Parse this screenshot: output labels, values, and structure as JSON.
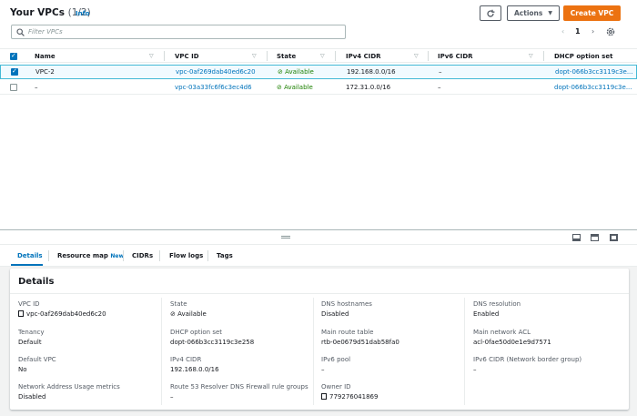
{
  "header": {
    "title": "Your VPCs",
    "count": "(1/2)",
    "info": "Info"
  },
  "toolbar": {
    "actions_label": "Actions",
    "create_label": "Create VPC",
    "refresh_icon": "refresh-icon",
    "settings_icon": "gear-icon"
  },
  "search": {
    "placeholder": "Filter VPCs"
  },
  "pagination": {
    "page": "1"
  },
  "table": {
    "columns": [
      "Name",
      "VPC ID",
      "State",
      "IPv4 CIDR",
      "IPv6 CIDR",
      "DHCP option set"
    ],
    "rows": [
      {
        "selected": true,
        "name": "VPC-2",
        "vpc_id": "vpc-0af269dab40ed6c20",
        "state": "Available",
        "ipv4": "192.168.0.0/16",
        "ipv6": "–",
        "dhcp": "dopt-066b3cc3119c3e..."
      },
      {
        "selected": false,
        "name": "–",
        "vpc_id": "vpc-03a33fc6f6c3ec4d6",
        "state": "Available",
        "ipv4": "172.31.0.0/16",
        "ipv6": "–",
        "dhcp": "dopt-066b3cc3119c3e..."
      }
    ]
  },
  "tabs": {
    "details": "Details",
    "resource_map": "Resource map",
    "new_badge": "New",
    "cidrs": "CIDRs",
    "flow_logs": "Flow logs",
    "tags": "Tags"
  },
  "details": {
    "title": "Details",
    "vpc_id_label": "VPC ID",
    "vpc_id": "vpc-0af269dab40ed6c20",
    "tenancy_label": "Tenancy",
    "tenancy": "Default",
    "default_vpc_label": "Default VPC",
    "default_vpc": "No",
    "nau_label": "Network Address Usage metrics",
    "nau": "Disabled",
    "state_label": "State",
    "state": "Available",
    "dhcp_label": "DHCP option set",
    "dhcp": "dopt-066b3cc3119c3e258",
    "ipv4_label": "IPv4 CIDR",
    "ipv4": "192.168.0.0/16",
    "r53_label": "Route 53 Resolver DNS Firewall rule groups",
    "r53": "–",
    "dns_hostnames_label": "DNS hostnames",
    "dns_hostnames": "Disabled",
    "main_rt_label": "Main route table",
    "main_rt": "rtb-0e0679d51dab58fa0",
    "ipv6_pool_label": "IPv6 pool",
    "ipv6_pool": "–",
    "owner_label": "Owner ID",
    "owner": "779276041869",
    "dns_res_label": "DNS resolution",
    "dns_res": "Enabled",
    "main_acl_label": "Main network ACL",
    "main_acl": "acl-0fae50d0e1e9d7571",
    "ipv6_nbg_label": "IPv6 CIDR (Network border group)",
    "ipv6_nbg": "–"
  },
  "colors": {
    "link": "#0073bb",
    "success": "#1d8102",
    "primary_button": "#ec7211"
  }
}
